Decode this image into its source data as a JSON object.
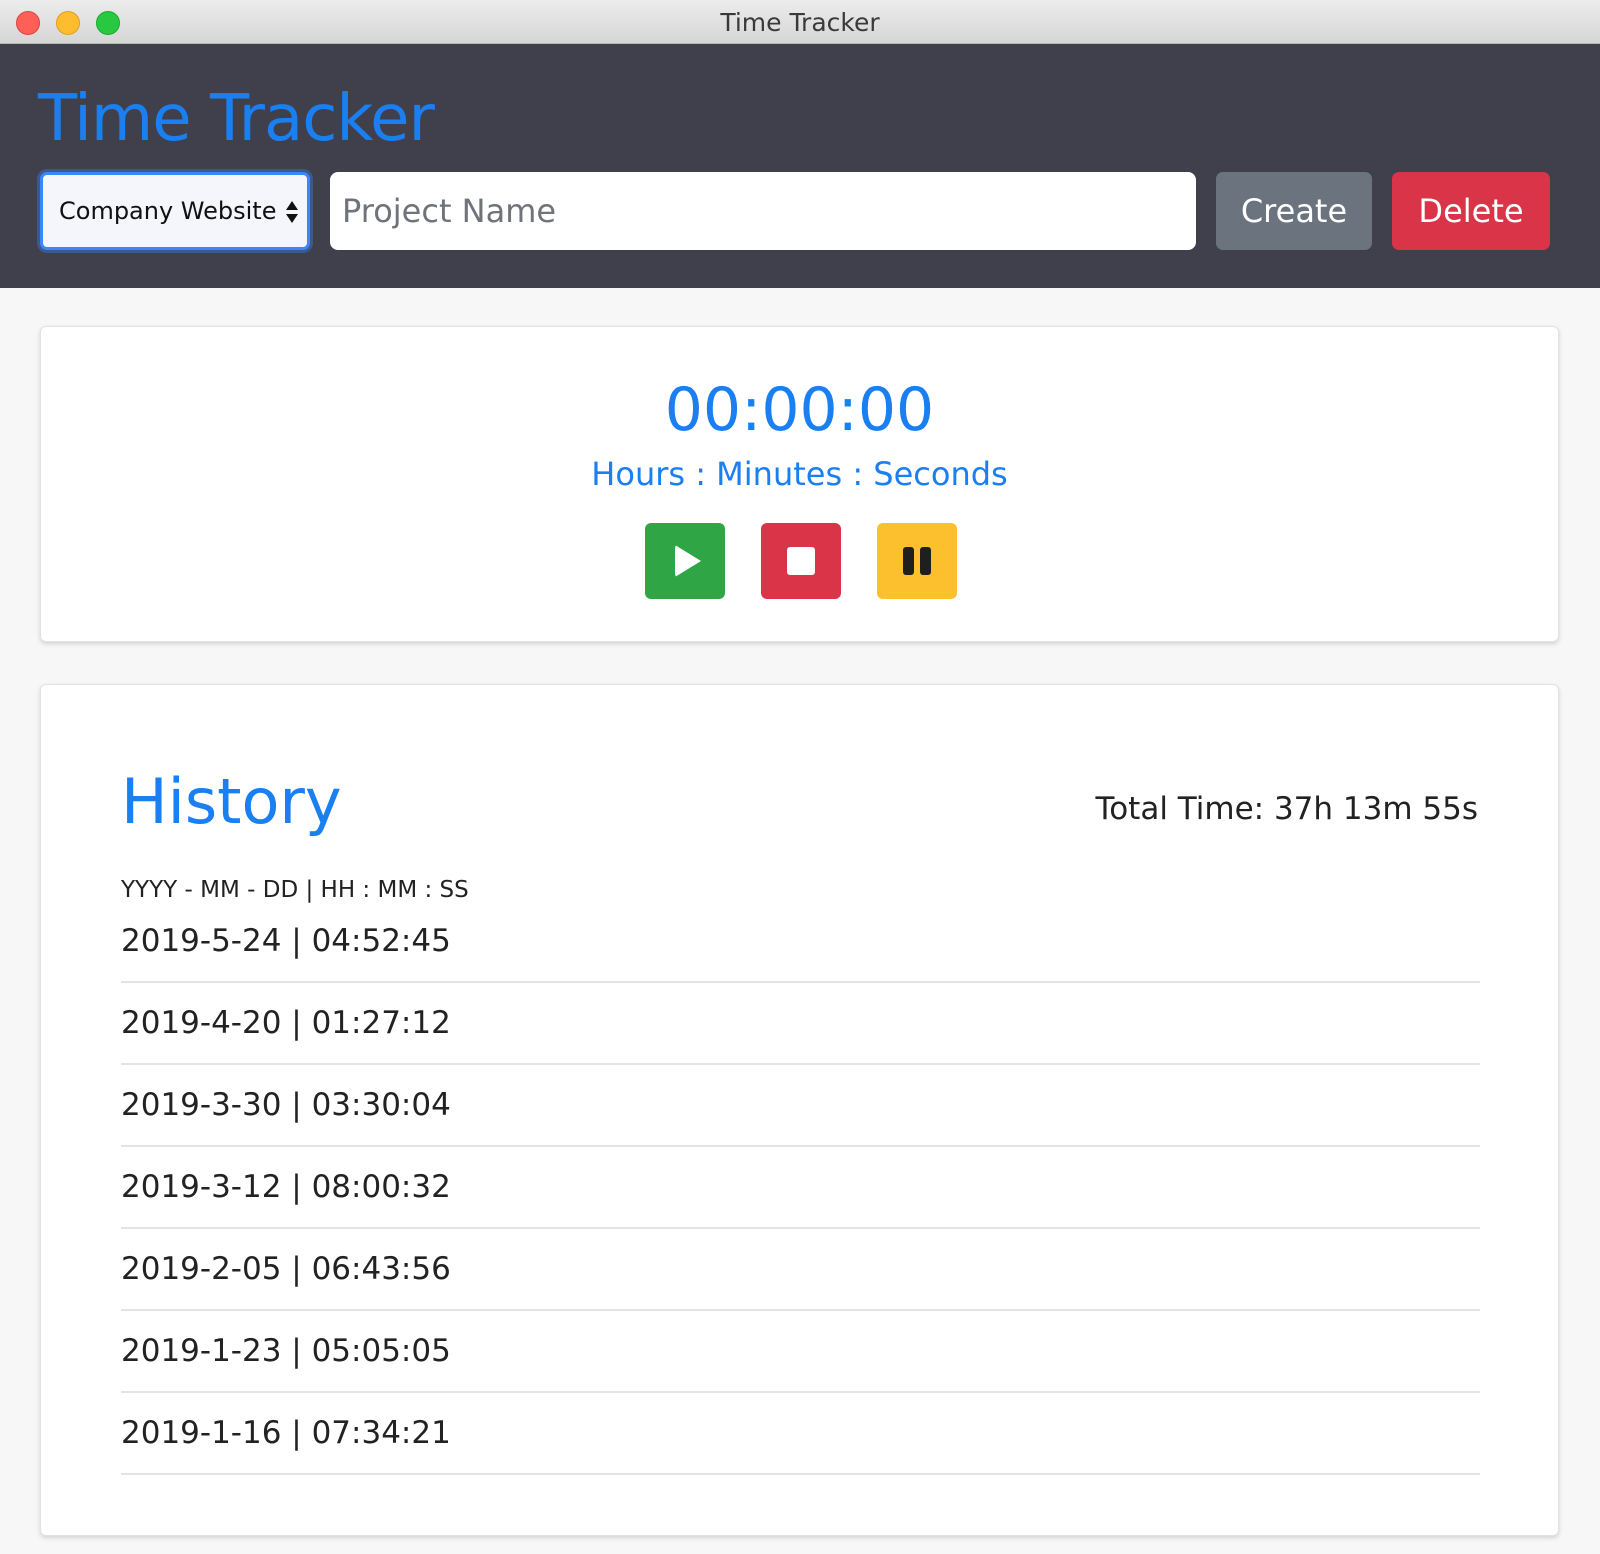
{
  "window": {
    "title": "Time Tracker"
  },
  "header": {
    "title": "Time Tracker",
    "project_select": {
      "selected": "Company Website"
    },
    "project_input": {
      "placeholder": "Project Name",
      "value": ""
    },
    "create_label": "Create",
    "delete_label": "Delete"
  },
  "timer": {
    "display": "00:00:00",
    "units": "Hours : Minutes : Seconds",
    "controls": [
      {
        "icon": "play-icon",
        "color": "#2fa545"
      },
      {
        "icon": "stop-icon",
        "color": "#da3448"
      },
      {
        "icon": "pause-icon",
        "color": "#fcc02e"
      }
    ]
  },
  "history": {
    "title": "History",
    "total_time": "Total Time: 37h 13m 55s",
    "format_hint": "YYYY - MM - DD | HH : MM : SS",
    "entries": [
      "2019-5-24 | 04:52:45",
      "2019-4-20 | 01:27:12",
      "2019-3-30 | 03:30:04",
      "2019-3-12 | 08:00:32",
      "2019-2-05 | 06:43:56",
      "2019-1-23 | 05:05:05",
      "2019-1-16 | 07:34:21"
    ]
  },
  "colors": {
    "accent": "#1a7ff0",
    "header_bg": "#40404d",
    "create": "#6b747e",
    "delete": "#da3448"
  }
}
